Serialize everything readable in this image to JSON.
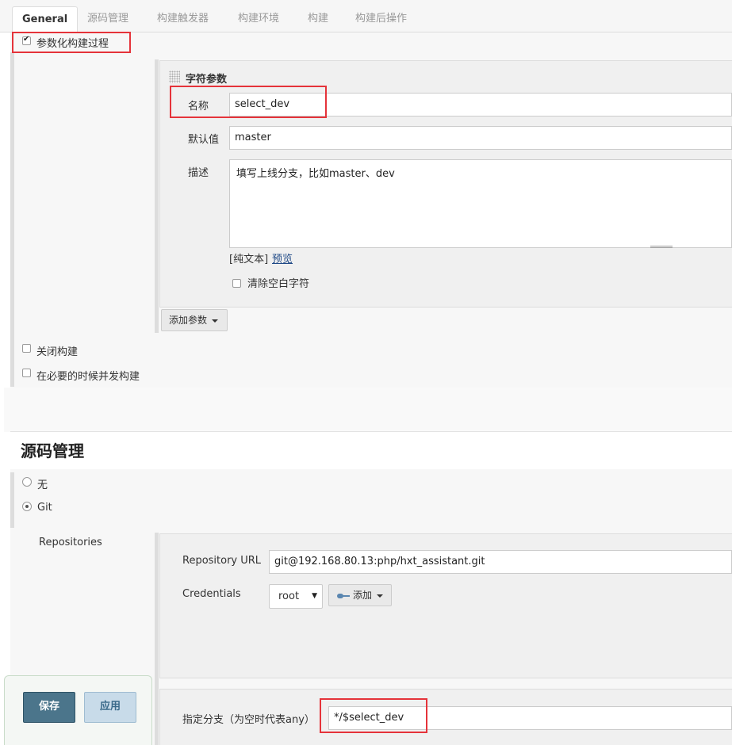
{
  "tabs": [
    {
      "label": "General"
    },
    {
      "label": "源码管理"
    },
    {
      "label": "构建触发器"
    },
    {
      "label": "构建环境"
    },
    {
      "label": "构建"
    },
    {
      "label": "构建后操作"
    }
  ],
  "general": {
    "parameterized_label": "参数化构建过程",
    "parameterized_checked": true,
    "string_param": {
      "title": "字符参数",
      "name_label": "名称",
      "name_value": "select_dev",
      "default_label": "默认值",
      "default_value": "master",
      "desc_label": "描述",
      "desc_value": "填写上线分支，比如master、dev",
      "plain_text": "[纯文本]",
      "preview": "预览",
      "trim_label": "清除空白字符"
    },
    "add_param_label": "添加参数",
    "disable_build_label": "关闭构建",
    "concurrent_label": "在必要的时候并发构建"
  },
  "scm": {
    "heading": "源码管理",
    "none_label": "无",
    "git_label": "Git",
    "repositories_label": "Repositories",
    "repo_url_label": "Repository URL",
    "repo_url_value": "git@192.168.80.13:php/hxt_assistant.git",
    "credentials_label": "Credentials",
    "credentials_value": "root",
    "add_label": "添加",
    "branch_label": "指定分支（为空时代表any）",
    "branch_value": "*/$select_dev"
  },
  "actions": {
    "save_label": "保存",
    "apply_label": "应用"
  },
  "colors": {
    "highlight": "#e5333a",
    "save_bg": "#4b758b",
    "apply_bg": "#c8dbe9"
  }
}
